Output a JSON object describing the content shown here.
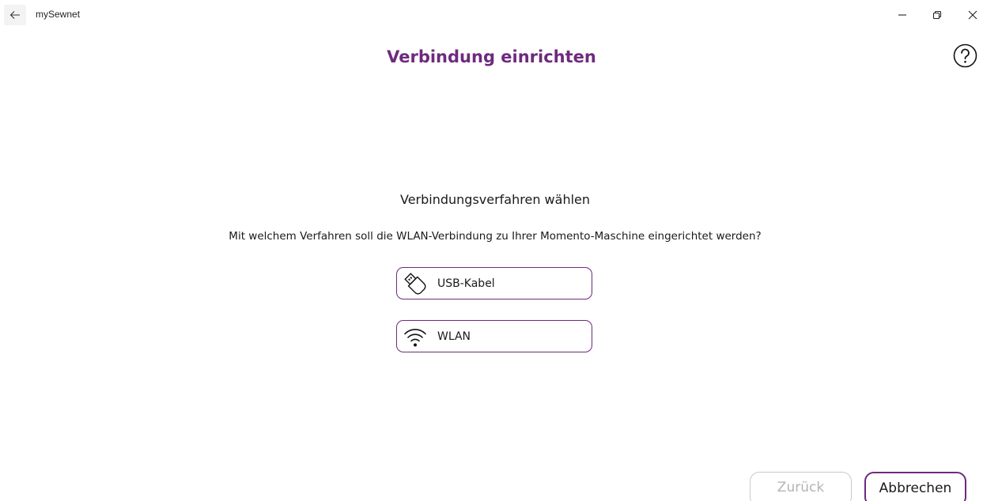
{
  "window": {
    "app_name": "mySewnet",
    "controls": [
      "minimize",
      "restore",
      "close"
    ]
  },
  "header": {
    "title": "Verbindung einrichten",
    "help_icon": "question-circle-icon"
  },
  "main": {
    "section_title": "Verbindungsverfahren wählen",
    "question": "Mit welchem Verfahren soll die WLAN-Verbindung zu Ihrer Momento-Maschine eingerichtet werden?",
    "options": [
      {
        "label": "USB-Kabel",
        "icon": "usb-stick-icon"
      },
      {
        "label": "WLAN",
        "icon": "wifi-icon"
      }
    ]
  },
  "footer": {
    "back_label": "Zurück",
    "back_enabled": false,
    "cancel_label": "Abbrechen"
  },
  "colors": {
    "accent": "#6e2a7e",
    "disabled_text": "#b4b4b4",
    "disabled_border": "#c9c9c9"
  }
}
